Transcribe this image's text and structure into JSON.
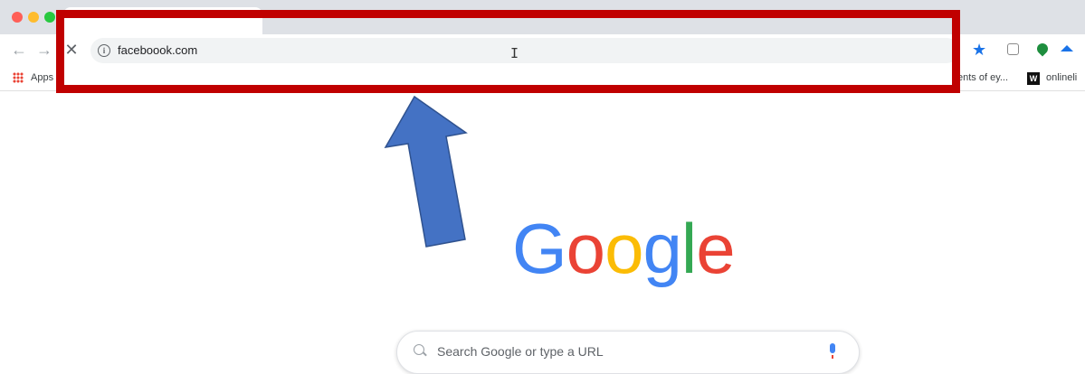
{
  "toolbar": {
    "url": "faceboook.com"
  },
  "bookmarks": {
    "apps_label": "Apps",
    "item_partial_eyes": "ents of ey...",
    "item_online": "onlineli",
    "online_favicon": "W"
  },
  "google": {
    "letters": [
      "G",
      "o",
      "o",
      "g",
      "l",
      "e"
    ],
    "colors": [
      "#4285F4",
      "#EA4335",
      "#FBBC05",
      "#4285F4",
      "#34A853",
      "#EA4335"
    ]
  },
  "search": {
    "placeholder": "Search Google or type a URL"
  },
  "annotations": {
    "highlight_color": "#C00000",
    "arrow_color": "#4472C4"
  }
}
